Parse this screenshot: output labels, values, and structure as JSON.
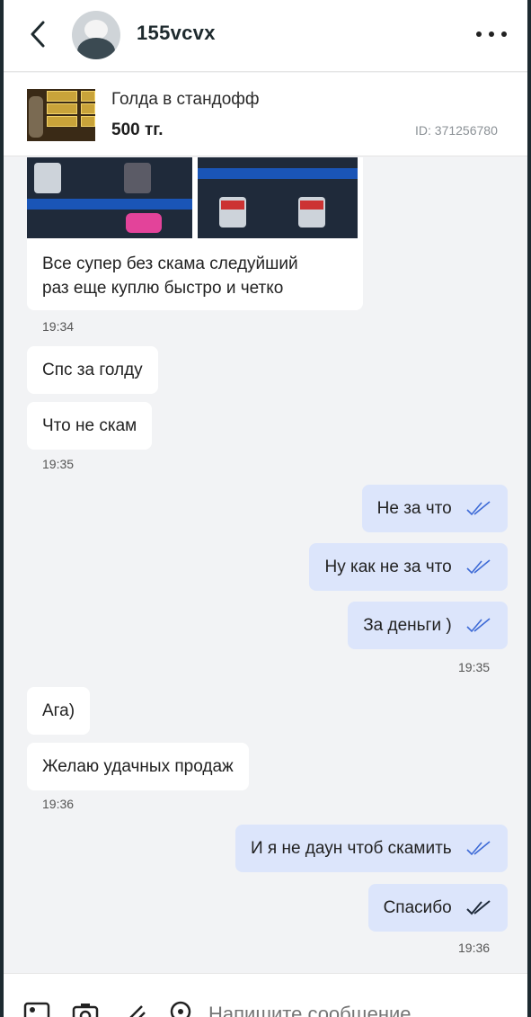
{
  "header": {
    "username": "155vcvx"
  },
  "product": {
    "title": "Голда в стандофф",
    "price": "500 тг.",
    "id_label": "ID: 371256780"
  },
  "messages": {
    "m1_line1": "Все супер без скама следуйший",
    "m1_line2": "раз еще куплю быстро и четко",
    "t1": "19:34",
    "m2": "Спс за голду",
    "m3": "Что не скам",
    "t2": "19:35",
    "m4": "Не за что",
    "m5": "Ну как не за что",
    "m6": "За деньги )",
    "t3": "19:35",
    "m7": "Ага)",
    "m8": "Желаю удачных продаж",
    "t4": "19:36",
    "m9": "И я не даун чтоб скамить",
    "m10": "Спасибо",
    "t5": "19:36"
  },
  "composer": {
    "placeholder": "Напишите сообщение"
  },
  "colors": {
    "outgoing_bubble": "#dce5fb",
    "incoming_bubble": "#ffffff",
    "read_tick": "#3d6ad6"
  },
  "icons": [
    "back-icon",
    "more-icon",
    "image-icon",
    "camera-icon",
    "attach-icon",
    "location-icon",
    "double-check-icon"
  ]
}
